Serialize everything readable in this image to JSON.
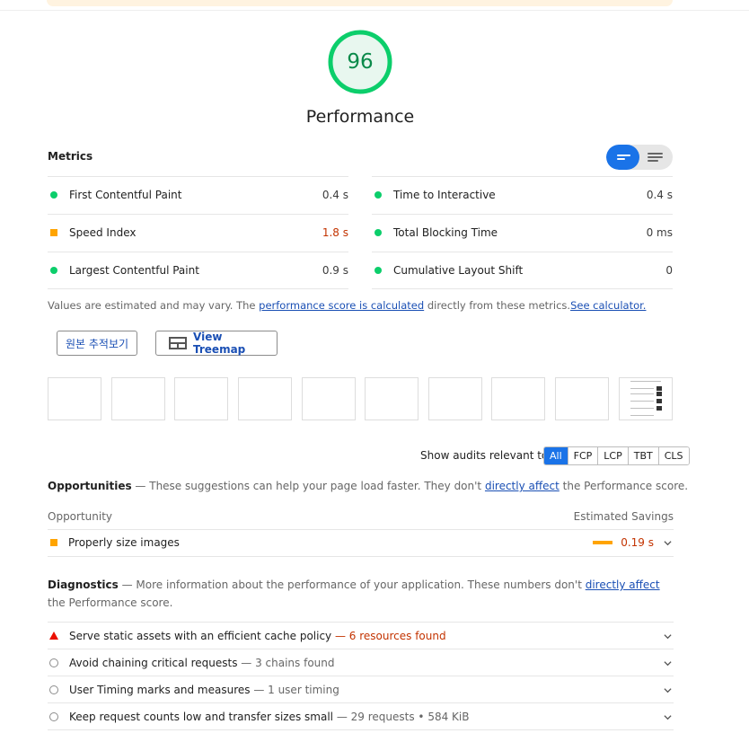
{
  "category": {
    "score": "96",
    "title": "Performance",
    "score_color": "#0cce6b"
  },
  "metrics": {
    "heading": "Metrics",
    "left": [
      {
        "label": "First Contentful Paint",
        "value": "0.4 s",
        "status": "pass"
      },
      {
        "label": "Speed Index",
        "value": "1.8 s",
        "status": "average"
      },
      {
        "label": "Largest Contentful Paint",
        "value": "0.9 s",
        "status": "pass"
      }
    ],
    "right": [
      {
        "label": "Time to Interactive",
        "value": "0.4 s",
        "status": "pass"
      },
      {
        "label": "Total Blocking Time",
        "value": "0 ms",
        "status": "pass"
      },
      {
        "label": "Cumulative Layout Shift",
        "value": "0",
        "status": "pass"
      }
    ],
    "note_prefix": "Values are estimated and may vary. The ",
    "note_link1": "performance score is calculated",
    "note_middle": " directly from these metrics.",
    "note_link2": "See calculator."
  },
  "buttons": {
    "original_trace": "원본 추적보기",
    "view_treemap": "View Treemap"
  },
  "filters": {
    "label": "Show audits relevant to:",
    "options": [
      "All",
      "FCP",
      "LCP",
      "TBT",
      "CLS"
    ],
    "active": "All"
  },
  "opportunities": {
    "title": "Opportunities",
    "desc_prefix": " — These suggestions can help your page load faster. They don't ",
    "desc_link": "directly affect",
    "desc_suffix": " the Performance score.",
    "col_left": "Opportunity",
    "col_right": "Estimated Savings",
    "items": [
      {
        "label": "Properly size images",
        "savings": "0.19 s"
      }
    ]
  },
  "diagnostics": {
    "title": "Diagnostics",
    "desc_prefix": " — More information about the performance of your application. These numbers don't ",
    "desc_link": "directly affect",
    "desc_suffix": " the Performance score.",
    "items": [
      {
        "label": "Serve static assets with an efficient cache policy",
        "detail": " — 6 resources found",
        "status": "fail"
      },
      {
        "label": "Avoid chaining critical requests",
        "detail": " — 3 chains found",
        "status": "info"
      },
      {
        "label": "User Timing marks and measures",
        "detail": " — 1 user timing",
        "status": "info"
      },
      {
        "label": "Keep request counts low and transfer sizes small",
        "detail": " — 29 requests • 584 KiB",
        "status": "info"
      }
    ]
  }
}
